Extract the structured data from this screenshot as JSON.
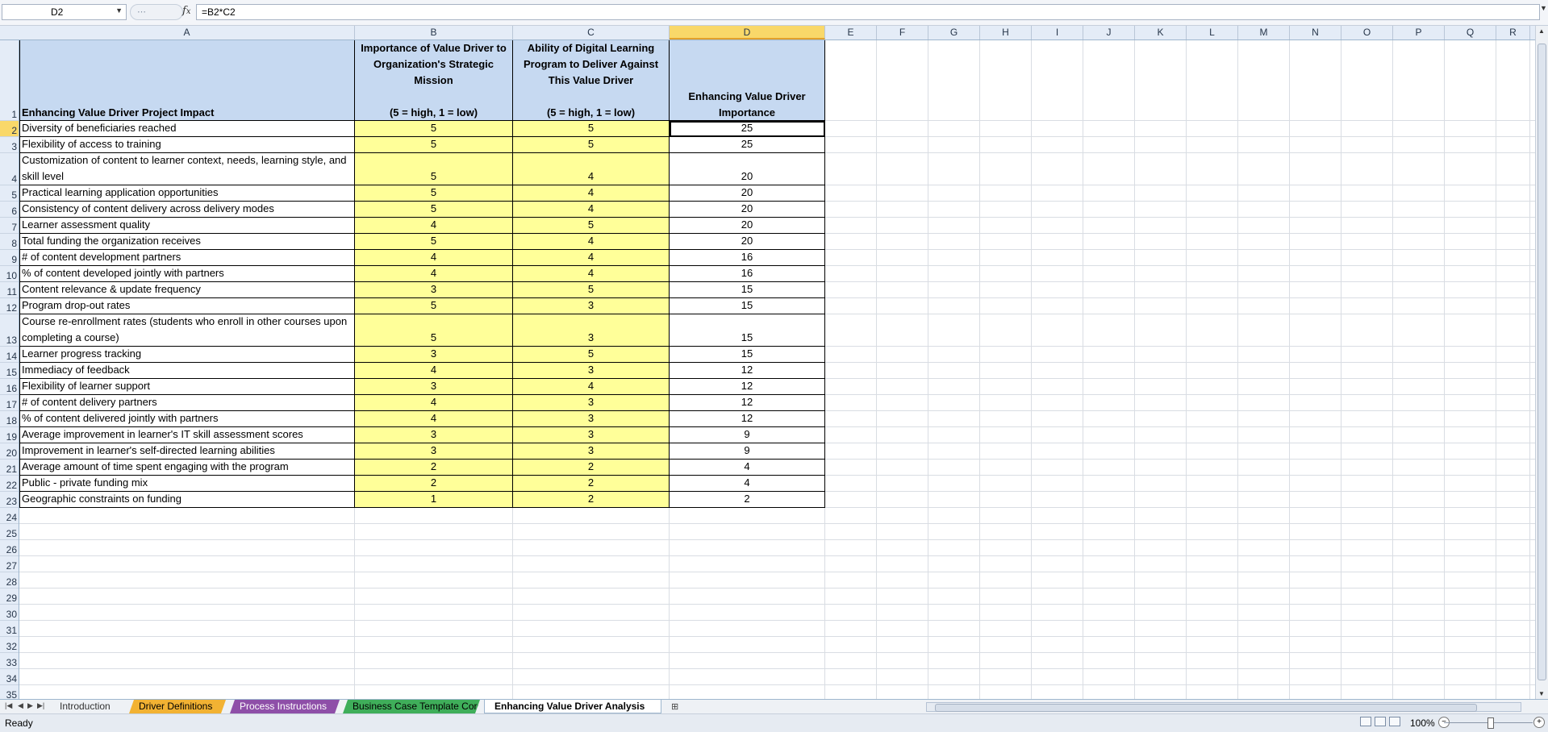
{
  "formula_bar": {
    "name_box": "D2",
    "fx": "fx",
    "formula": "=B2*C2"
  },
  "columns": [
    "A",
    "B",
    "C",
    "D",
    "E",
    "F",
    "G",
    "H",
    "I",
    "J",
    "K",
    "L",
    "M",
    "N",
    "O",
    "P",
    "Q",
    "R"
  ],
  "header_row": {
    "A": "Enhancing Value Driver Project Impact",
    "B": "Importance of Value Driver to Organization's Strategic Mission\n\n(5 = high, 1 = low)",
    "C": "Ability of Digital Learning Program to Deliver Against This Value Driver\n\n(5 = high, 1 = low)",
    "D": "Enhancing Value Driver Importance"
  },
  "rows": [
    {
      "a": "Diversity of beneficiaries reached",
      "b": "5",
      "c": "5",
      "d": "25"
    },
    {
      "a": "Flexibility of access to training",
      "b": "5",
      "c": "5",
      "d": "25"
    },
    {
      "a": "Customization of content to learner context, needs, learning style, and skill level",
      "b": "5",
      "c": "4",
      "d": "20"
    },
    {
      "a": "Practical learning application opportunities",
      "b": "5",
      "c": "4",
      "d": "20"
    },
    {
      "a": "Consistency of content delivery across  delivery modes",
      "b": "5",
      "c": "4",
      "d": "20"
    },
    {
      "a": "Learner assessment quality",
      "b": "4",
      "c": "5",
      "d": "20"
    },
    {
      "a": "Total funding the organization receives",
      "b": "5",
      "c": "4",
      "d": "20"
    },
    {
      "a": "# of content development partners",
      "b": "4",
      "c": "4",
      "d": "16"
    },
    {
      "a": "% of content developed jointly with partners",
      "b": "4",
      "c": "4",
      "d": "16"
    },
    {
      "a": "Content relevance & update frequency",
      "b": "3",
      "c": "5",
      "d": "15"
    },
    {
      "a": "Program drop-out rates",
      "b": "5",
      "c": "3",
      "d": "15"
    },
    {
      "a": "Course re-enrollment rates (students who enroll in other courses upon completing a course)",
      "b": "5",
      "c": "3",
      "d": "15"
    },
    {
      "a": "Learner progress tracking",
      "b": "3",
      "c": "5",
      "d": "15"
    },
    {
      "a": "Immediacy of feedback",
      "b": "4",
      "c": "3",
      "d": "12"
    },
    {
      "a": "Flexibility of learner support",
      "b": "3",
      "c": "4",
      "d": "12"
    },
    {
      "a": "# of content delivery partners",
      "b": "4",
      "c": "3",
      "d": "12"
    },
    {
      "a": "% of content delivered jointly with partners",
      "b": "4",
      "c": "3",
      "d": "12"
    },
    {
      "a": "Average improvement in learner's IT skill assessment scores",
      "b": "3",
      "c": "3",
      "d": "9"
    },
    {
      "a": "Improvement in learner's self-directed learning abilities",
      "b": "3",
      "c": "3",
      "d": "9"
    },
    {
      "a": "Average amount of time spent engaging with the program",
      "b": "2",
      "c": "2",
      "d": "4"
    },
    {
      "a": "Public - private funding mix",
      "b": "2",
      "c": "2",
      "d": "4"
    },
    {
      "a": "Geographic constraints on funding",
      "b": "1",
      "c": "2",
      "d": "2"
    }
  ],
  "row_numbers": [
    "1",
    "2",
    "3",
    "4",
    "5",
    "6",
    "7",
    "8",
    "9",
    "10",
    "11",
    "12",
    "13",
    "14",
    "15",
    "16",
    "17",
    "18",
    "19",
    "20",
    "21",
    "22",
    "23",
    "24",
    "25",
    "26",
    "27",
    "28",
    "29",
    "30",
    "31",
    "32",
    "33",
    "34",
    "35"
  ],
  "sheet_tabs": [
    {
      "label": "Introduction",
      "color": "#eef1f5",
      "text": "#333333"
    },
    {
      "label": "Driver Definitions",
      "color": "#f2b233",
      "text": "#000000"
    },
    {
      "label": "Process Instructions",
      "color": "#8e4fa8",
      "text": "#ffffff"
    },
    {
      "label": "Business Case Template Core",
      "color": "#3fae5a",
      "text": "#000000"
    },
    {
      "label": "Enhancing Value Driver Analysis",
      "color": "#ffffff",
      "text": "#000000",
      "active": true
    }
  ],
  "status": {
    "ready": "Ready",
    "zoom": "100%"
  }
}
